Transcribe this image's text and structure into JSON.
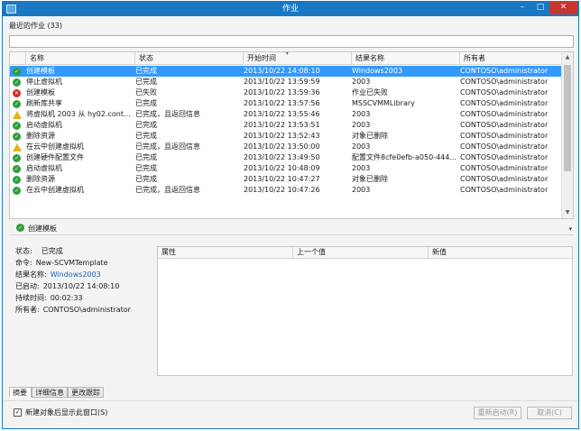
{
  "window": {
    "title": "作业",
    "controls": {
      "minimize": "–",
      "maximize": "□",
      "close": "✕"
    }
  },
  "recent_label": "最近的作业 (33)",
  "search": {
    "value": "",
    "placeholder": ""
  },
  "grid": {
    "columns": [
      "名称",
      "状态",
      "开始时间",
      "结果名称",
      "所有者"
    ],
    "rows": [
      {
        "icon": "ok",
        "name": "创建模板",
        "status": "已完成",
        "start": "2013/10/22 14:08:10",
        "result": "Windows2003",
        "owner": "CONTOSO\\administrator",
        "selected": true
      },
      {
        "icon": "ok",
        "name": "停止虚拟机",
        "status": "已完成",
        "start": "2013/10/22 13:59:59",
        "result": "2003",
        "owner": "CONTOSO\\administrator"
      },
      {
        "icon": "err",
        "name": "创建模板",
        "status": "已失败",
        "start": "2013/10/22 13:59:36",
        "result": "作业已失败",
        "owner": "CONTOSO\\administrator"
      },
      {
        "icon": "ok",
        "name": "刷新库共享",
        "status": "已完成",
        "start": "2013/10/22 13:57:56",
        "result": "MSSCVMMLibrary",
        "owner": "CONTOSO\\administrator"
      },
      {
        "icon": "warn",
        "name": "将虚拟机 2003 从 hy02.conto...",
        "status": "已完成，且返回信息",
        "start": "2013/10/22 13:55:46",
        "result": "2003",
        "owner": "CONTOSO\\administrator"
      },
      {
        "icon": "ok",
        "name": "启动虚拟机",
        "status": "已完成",
        "start": "2013/10/22 13:53:51",
        "result": "2003",
        "owner": "CONTOSO\\administrator"
      },
      {
        "icon": "ok",
        "name": "删除资源",
        "status": "已完成",
        "start": "2013/10/22 13:52:43",
        "result": "对象已删除",
        "owner": "CONTOSO\\administrator"
      },
      {
        "icon": "warn",
        "name": "在云中创建虚拟机",
        "status": "已完成，且返回信息",
        "start": "2013/10/22 13:50:00",
        "result": "2003",
        "owner": "CONTOSO\\administrator"
      },
      {
        "icon": "ok",
        "name": "创建硬件配置文件",
        "status": "已完成",
        "start": "2013/10/22 13:49:50",
        "result": "配置文件8cfe0efb-a050-444...",
        "owner": "CONTOSO\\administrator"
      },
      {
        "icon": "ok",
        "name": "启动虚拟机",
        "status": "已完成",
        "start": "2013/10/22 10:48:09",
        "result": "2003",
        "owner": "CONTOSO\\administrator"
      },
      {
        "icon": "ok",
        "name": "删除资源",
        "status": "已完成",
        "start": "2013/10/22 10:47:27",
        "result": "对象已删除",
        "owner": "CONTOSO\\administrator"
      },
      {
        "icon": "ok",
        "name": "在云中创建虚拟机",
        "status": "已完成，且返回信息",
        "start": "2013/10/22 10:47:26",
        "result": "2003",
        "owner": "CONTOSO\\administrator"
      }
    ]
  },
  "detail": {
    "title": "创建模板",
    "status_label": "状态:",
    "status_value": "已完成",
    "command_label": "命令:",
    "command_value": "New-SCVMTemplate",
    "result_label": "结果名称:",
    "result_value": "Windows2003",
    "started_label": "已启动:",
    "started_value": "2013/10/22 14:08:10",
    "duration_label": "持续时间:",
    "duration_value": "00:02:33",
    "owner_label": "所有者:",
    "owner_value": "CONTOSO\\administrator",
    "change_columns": [
      "属性",
      "上一个值",
      "新值"
    ]
  },
  "tabs": [
    "摘要",
    "详细信息",
    "更改跟踪"
  ],
  "footer": {
    "checkbox_label": "新建对象后显示此窗口(S)",
    "checkbox_checked": true,
    "restart_button": "重新启动(R)",
    "cancel_button": "取消(C)"
  },
  "colors": {
    "titlebar": "#1a78c2",
    "selection": "#3399ff",
    "close_button": "#c7362d",
    "link": "#1f5fb5"
  }
}
